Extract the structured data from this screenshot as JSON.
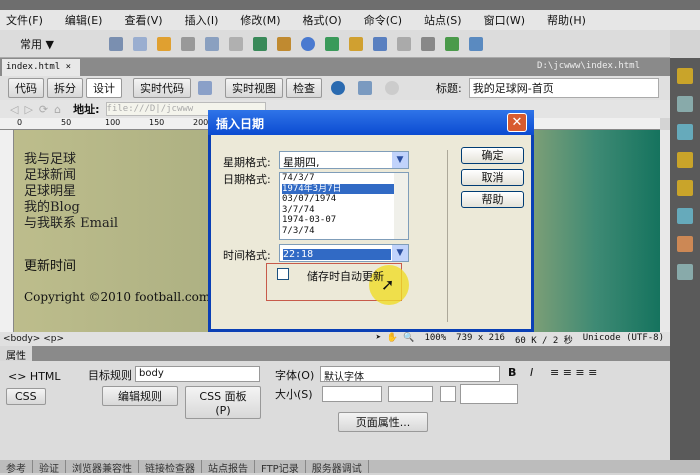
{
  "menu": [
    "文件(F)",
    "编辑(E)",
    "查看(V)",
    "插入(I)",
    "修改(M)",
    "格式(O)",
    "命令(C)",
    "站点(S)",
    "窗口(W)",
    "帮助(H)"
  ],
  "insert_bar": {
    "category": "常用 ▼"
  },
  "doc": {
    "tab": "index.html ×",
    "path": "D:\\jcwww\\index.html"
  },
  "doc_toolbar": {
    "code": "代码",
    "split": "拆分",
    "design": "设计",
    "live_code": "实时代码",
    "live_view": "实时视图",
    "inspect": "检查",
    "title_label": "标题:",
    "title_value": "我的足球网-首页"
  },
  "address": {
    "label": "地址:",
    "value": "file:///D|/jcwww"
  },
  "ruler": [
    "0",
    "50",
    "100",
    "150",
    "200"
  ],
  "page": {
    "nav": [
      "我与足球",
      "足球新闻",
      "足球明星",
      "我的Blog",
      "与我联系 Email"
    ],
    "update": "更新时间",
    "copyright": "Copyright ©2010 football.com Inc"
  },
  "status": {
    "tags": "<body> <p>",
    "zoom": "100%",
    "size": "739 x 216",
    "download": "60 K / 2 秒",
    "encoding": "Unicode (UTF-8)"
  },
  "props": {
    "title": "属性",
    "html": "<> HTML",
    "css": "CSS",
    "target_rule_label": "目标规则",
    "target_rule": "body",
    "edit_rule": "编辑规则",
    "css_panel": "CSS 面板(P)",
    "font_label": "字体(O)",
    "font": "默认字体",
    "size_label": "大小(S)",
    "page_props": "页面属性..."
  },
  "bottom_tabs": [
    "参考",
    "验证",
    "浏览器兼容性",
    "链接检查器",
    "站点报告",
    "FTP记录",
    "服务器调试"
  ],
  "dialog": {
    "title": "插入日期",
    "weekday_label": "星期格式:",
    "weekday": "星期四,",
    "date_label": "日期格式:",
    "dates": [
      "74/3/7",
      "1974年3月7日",
      "03/07/1974",
      "3/7/74",
      "1974-03-07",
      "7/3/74"
    ],
    "selected_date": 1,
    "time_label": "时间格式:",
    "time": "22:18",
    "auto_update": "储存时自动更新",
    "auto_update_checked": false,
    "ok": "确定",
    "cancel": "取消",
    "help": "帮助"
  }
}
